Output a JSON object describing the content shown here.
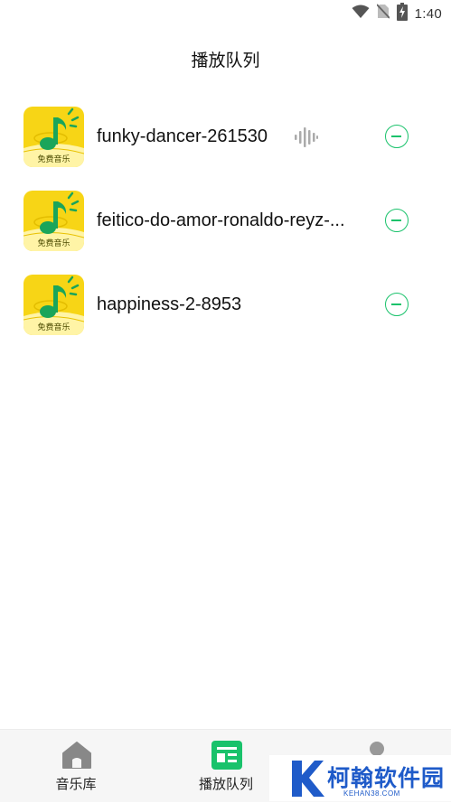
{
  "status_bar": {
    "time": "1:40",
    "icons": [
      "wifi-icon",
      "no-sim-icon",
      "battery-charging-icon"
    ]
  },
  "header": {
    "title": "播放队列"
  },
  "queue": {
    "items": [
      {
        "title": "funky-dancer-261530",
        "cover_label": "免费音乐",
        "playing": true,
        "action_icon": "remove-circle-icon"
      },
      {
        "title": "feitico-do-amor-ronaldo-reyz-...",
        "cover_label": "免费音乐",
        "playing": false,
        "action_icon": "remove-circle-icon"
      },
      {
        "title": "happiness-2-8953",
        "cover_label": "免费音乐",
        "playing": false,
        "action_icon": "remove-circle-icon"
      }
    ]
  },
  "bottom_nav": {
    "items": [
      {
        "label": "音乐库",
        "icon": "home-icon",
        "active": false
      },
      {
        "label": "播放队列",
        "icon": "queue-icon",
        "active": true
      },
      {
        "label": "",
        "icon": "profile-icon",
        "active": false
      }
    ]
  },
  "watermark": {
    "text": "柯翰软件园",
    "sub": "KEHAN38.COM"
  },
  "colors": {
    "accent": "#19c26b",
    "cover_yellow": "#f7d516",
    "note_green": "#1aa55a",
    "watermark_blue": "#1f5bc9"
  }
}
